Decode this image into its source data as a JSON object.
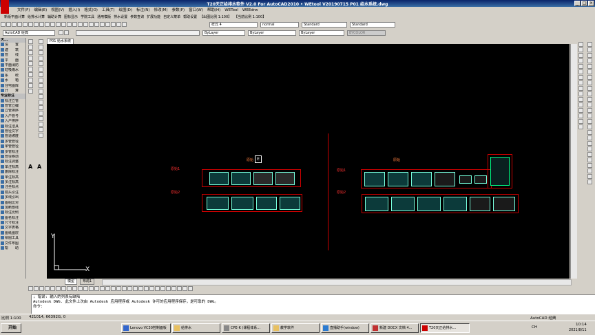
{
  "window": {
    "title": "T20天正给排水软件 V2.0 For AutoCAD2010 • WEtool V20190715  P01 给水系统.dwg",
    "min_label": "_",
    "max_label": "□",
    "close_label": "×"
  },
  "menu": [
    "文件(F)",
    "编辑(E)",
    "视图(V)",
    "插入(I)",
    "格式(O)",
    "工具(T)",
    "绘图(D)",
    "标注(N)",
    "修改(M)",
    "参数(P)",
    "窗口(W)",
    "帮助(H)",
    "WETool",
    "WEEdrw"
  ],
  "tianzheng_menu": [
    "新版平面计算",
    "给排水计算",
    "辅助计算",
    "图标显示",
    "学院工具",
    "通用模版",
    "排水设置",
    "参数查询",
    "扩展功能",
    "自定义菜单",
    "帮助设置",
    "【出图比例 1:100】",
    "【当前比例 1:100】"
  ],
  "toolbar": {
    "workspace": "AutoCAD 经典",
    "textstyle": "样式 4",
    "dimstyle": "normal",
    "tablestyle": "Standard",
    "mlstyle": "Standard",
    "layer_bylayer1": "ByLayer",
    "layer_bylayer2": "ByLayer",
    "layer_bylayer3": "ByLayer",
    "color_bycolor": "BYCOLOR"
  },
  "left_panel": {
    "header": "天...",
    "items": [
      "设　　置",
      "建　　筑",
      "管　　线",
      "平　　面",
      "平面消防",
      "虹吸雨水",
      "系　　统",
      "水　　箱",
      "住宅图库",
      "计　　算"
    ],
    "section": "专业标注",
    "labels": [
      "标注立管",
      "管管立编",
      "立管排序",
      "入户管号",
      "入户排序",
      "标注洁具",
      "管径文字",
      "管道坡度",
      "多管管径",
      "单管管径",
      "多管标注",
      "管径移动",
      "标注调整",
      "单注标高",
      "删除标注",
      "单注标高",
      "多注标高",
      "注坐标点",
      "箭头引注",
      "多线引出",
      "图组比对",
      "加断剖线",
      "标注比例",
      "图名标注"
    ],
    "section2_labels": [
      "尺寸标注",
      "文字表格",
      "图纸图层",
      "绘图工具",
      "文件布图",
      "帮　　助"
    ],
    "big_a": "A"
  },
  "document": {
    "tab": "P01 给水系统",
    "model_tab": "模型",
    "layout_tab": "布局1",
    "left_group_title": "原始",
    "right_group_title": "原始",
    "small_label_e": "E",
    "left_tag1": "原始1",
    "left_tag2": "原始2",
    "right_tag1": "原始1",
    "right_tag2": "原始2",
    "ucs_x": "X",
    "ucs_y": "Y"
  },
  "command": {
    "line1": "; 错误: 输入的列表有缺陷",
    "line2": "Autodesk DWG.  此文件上次由 Autodesk 应用程序或 Autodesk 许可的应用程序保存，是可靠的 DWG。",
    "prompt": "命令:"
  },
  "status": {
    "scale": "比例 1:100",
    "coords": "421014, 66392G, 0",
    "app": "AutoCAD 经典"
  },
  "taskbar": {
    "start": "开始",
    "items": [
      "Lenovo VC30控制面板",
      "给排水",
      "CPE-K (课程体系...",
      "教学软件",
      "直播助手(window)",
      "新建 DOCX 文档 4...",
      "T20天正给排水..."
    ],
    "time": "10:14",
    "date": "2021/8/11",
    "lang": "CH"
  },
  "colors": {
    "accent": "#0a246a",
    "canvas": "#000000",
    "frame": "#cc0000",
    "thumb": "#7fddd0"
  }
}
